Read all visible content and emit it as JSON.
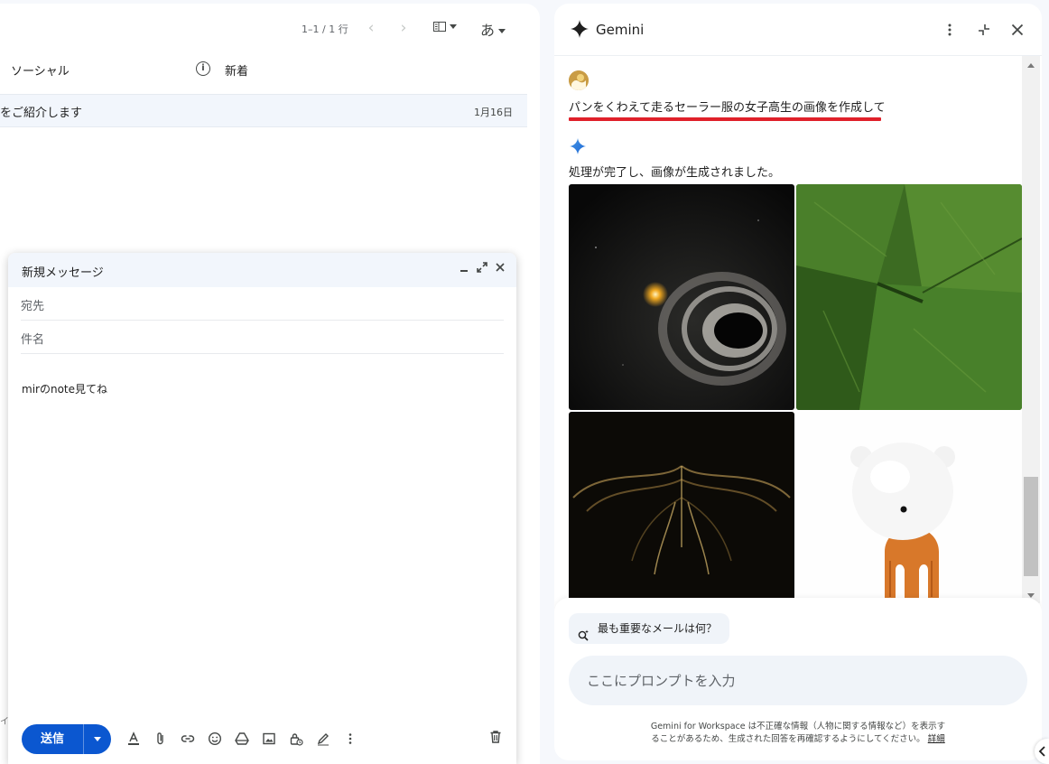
{
  "mail": {
    "pagination": "1–1 / 1 行",
    "ime_label": "あ",
    "tab_social": "ソーシャル",
    "tab_new": "新着",
    "row_subject": "をご紹介します",
    "row_date": "1月16日",
    "left_cut": "イ"
  },
  "compose": {
    "title": "新規メッセージ",
    "to_placeholder": "宛先",
    "subject_placeholder": "件名",
    "body": "mirのnote見てね",
    "send_label": "送信"
  },
  "gemini": {
    "title": "Gemini",
    "user_prompt": "パンをくわえて走るセーラー服の女子高生の画像を作成して",
    "response": "処理が完了し、画像が生成されました。",
    "suggestion": "最も重要なメールは何？",
    "input_placeholder": "ここにプロンプトを入力",
    "disclaimer_line1": "Gemini for Workspace は不正確な情報（人物に関する情報など）を表示す",
    "disclaimer_line2": "ることがあるため、生成された回答を再確認するようにしてください。",
    "disclaimer_link": "詳細",
    "accent_color": "#0b57d0",
    "underline_color": "#e0202a"
  }
}
